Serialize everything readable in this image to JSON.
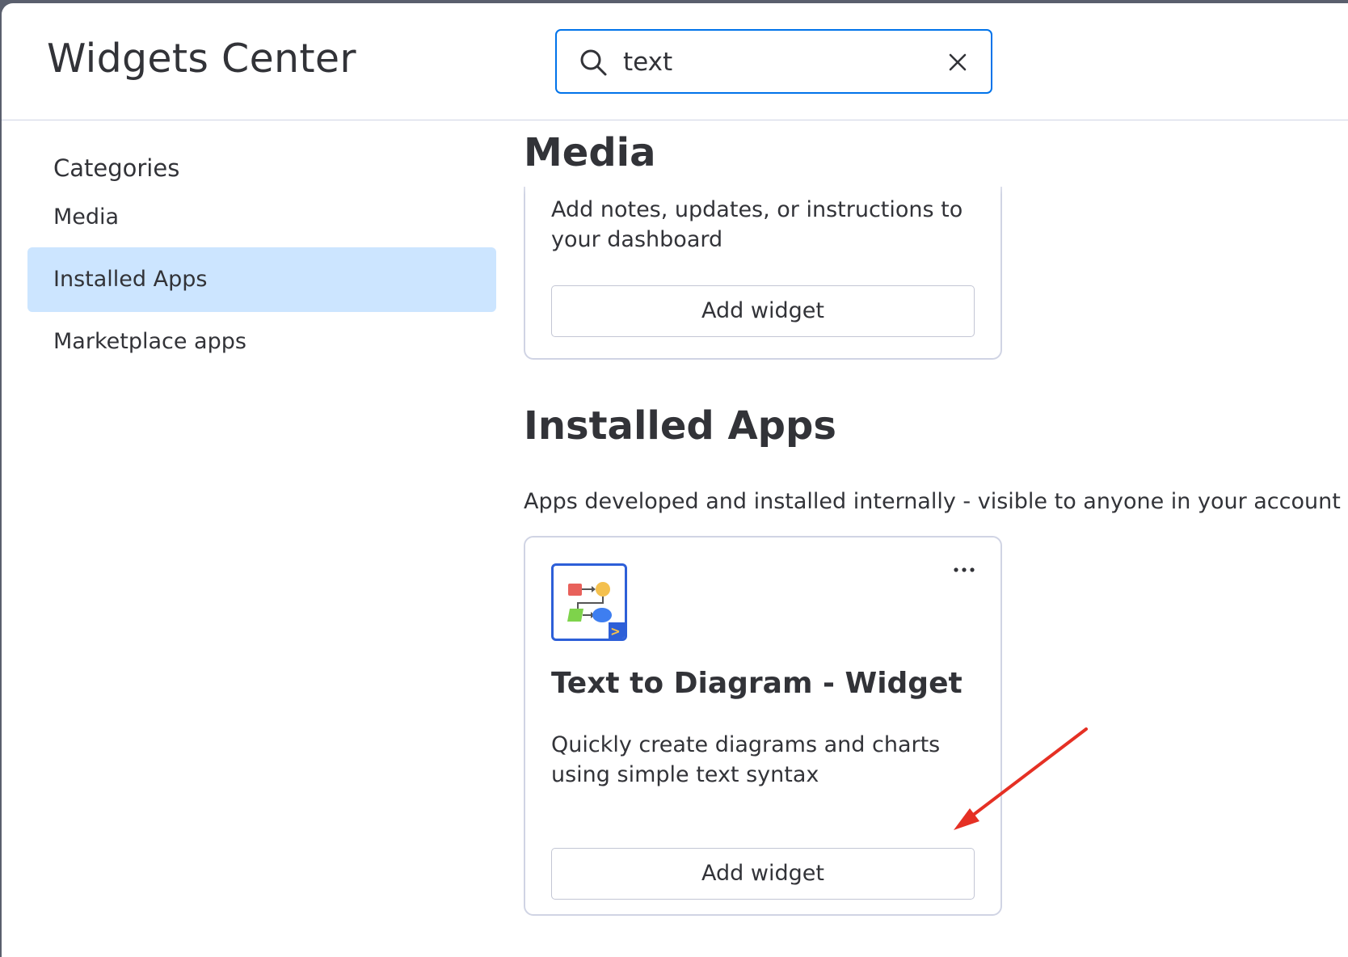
{
  "header": {
    "title": "Widgets Center",
    "search": {
      "value": "text",
      "search_icon": "search-icon",
      "clear_icon": "close-icon"
    }
  },
  "sidebar": {
    "heading": "Categories",
    "items": [
      {
        "label": "Media",
        "selected": false
      },
      {
        "label": "Installed Apps",
        "selected": true
      },
      {
        "label": "Marketplace apps",
        "selected": false
      }
    ]
  },
  "sections": {
    "media": {
      "title": "Media",
      "card": {
        "description": "Add notes, updates, or instructions to your dashboard",
        "button_label": "Add widget"
      }
    },
    "installed_apps": {
      "title": "Installed Apps",
      "description": "Apps developed and installed internally - visible to anyone in your account",
      "card": {
        "icon": "flowchart-app-icon",
        "title": "Text to Diagram - Widget",
        "description": "Quickly create diagrams and charts using simple text syntax",
        "button_label": "Add widget",
        "menu_icon": "more-options-icon"
      }
    }
  },
  "colors": {
    "accent": "#0073ea",
    "selected_bg": "#cce5ff",
    "border": "#d0d4e4",
    "annotation": "#e53024"
  }
}
